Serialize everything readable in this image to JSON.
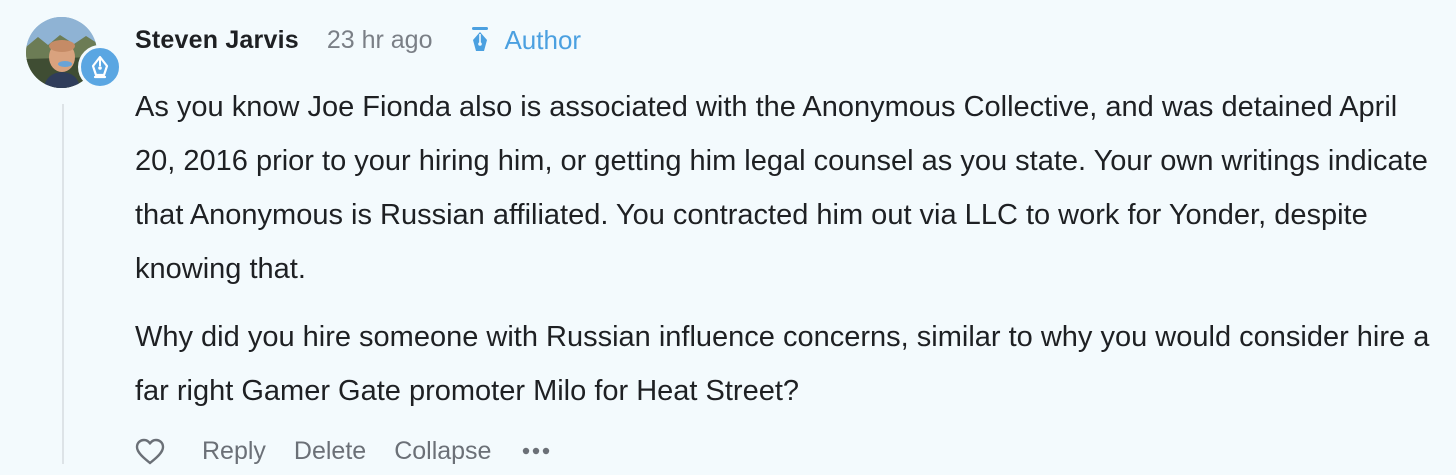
{
  "comment": {
    "author": "Steven Jarvis",
    "timestamp": "23 hr ago",
    "badge_label": "Author",
    "paragraphs": [
      "As you know Joe Fionda also is associated with the Anonymous Collective, and was detained April 20, 2016 prior to your hiring him, or getting him legal counsel as you state. Your own writings indicate that Anonymous is Russian affiliated. You contracted him out via LLC to work for Yonder, despite knowing that.",
      "Why did you hire someone with Russian influence concerns, similar to why you would consider hire a far right Gamer Gate promoter Milo for Heat Street?"
    ],
    "actions": {
      "like_icon": "heart-icon",
      "reply": "Reply",
      "delete": "Delete",
      "collapse": "Collapse",
      "more_icon": "ellipsis-icon"
    }
  },
  "colors": {
    "background": "#f3fafd",
    "accent": "#4ba0e0",
    "badge": "#5aa6e2",
    "text": "#1e2023",
    "muted": "#6b7077"
  },
  "icons": {
    "avatar_badge": "fountain-pen-icon",
    "author_badge": "fountain-pen-icon"
  }
}
